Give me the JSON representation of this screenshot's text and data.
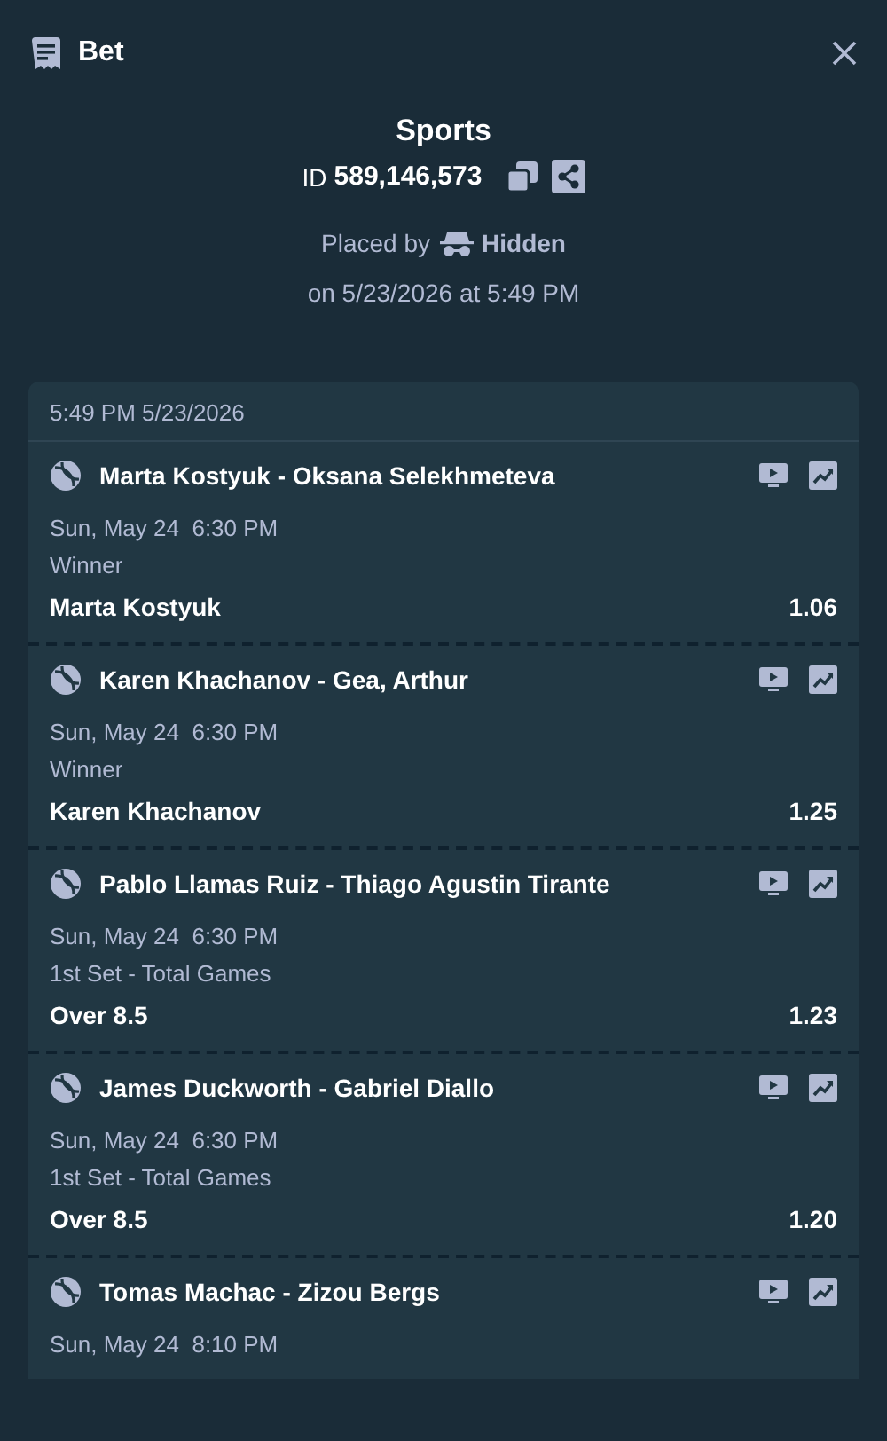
{
  "header": {
    "title": "Bet"
  },
  "bet": {
    "category": "Sports",
    "id_label": "ID",
    "id_value": "589,146,573",
    "placed_by_label": "Placed by",
    "placed_by_user": "Hidden",
    "placed_on": "on 5/23/2026 at 5:49 PM"
  },
  "slip": {
    "timestamp": "5:49 PM 5/23/2026",
    "legs": [
      {
        "match": "Marta Kostyuk - Oksana Selekhmeteva",
        "start": "Sun, May 24  6:30 PM",
        "market": "Winner",
        "selection": "Marta Kostyuk",
        "odds": "1.06"
      },
      {
        "match": "Karen Khachanov - Gea, Arthur",
        "start": "Sun, May 24  6:30 PM",
        "market": "Winner",
        "selection": "Karen Khachanov",
        "odds": "1.25"
      },
      {
        "match": "Pablo Llamas Ruiz - Thiago Agustin Tirante",
        "start": "Sun, May 24  6:30 PM",
        "market": "1st Set - Total Games",
        "selection": "Over 8.5",
        "odds": "1.23"
      },
      {
        "match": "James Duckworth - Gabriel Diallo",
        "start": "Sun, May 24  6:30 PM",
        "market": "1st Set - Total Games",
        "selection": "Over 8.5",
        "odds": "1.20"
      },
      {
        "match": "Tomas Machac - Zizou Bergs",
        "start": "Sun, May 24  8:10 PM"
      }
    ]
  }
}
